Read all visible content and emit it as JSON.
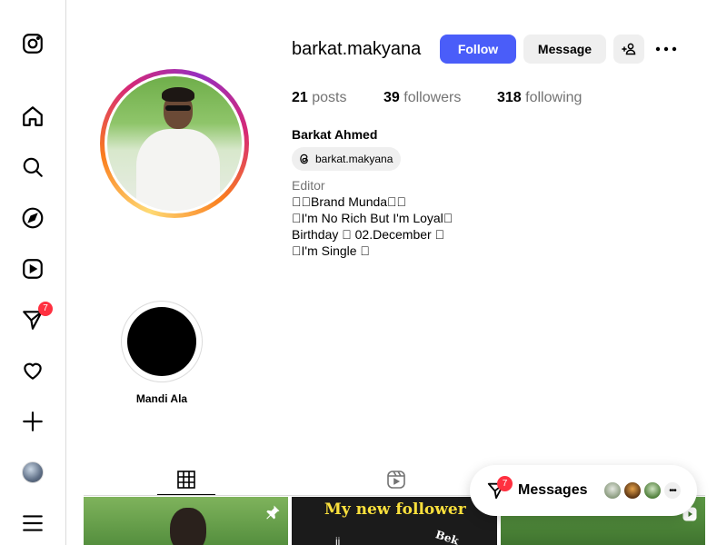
{
  "sidebar": {
    "items": [
      {
        "name": "instagram-logo-icon"
      },
      {
        "name": "home-icon"
      },
      {
        "name": "search-icon"
      },
      {
        "name": "explore-icon"
      },
      {
        "name": "reels-icon"
      },
      {
        "name": "messages-icon",
        "badge": "7"
      },
      {
        "name": "notifications-heart-icon"
      },
      {
        "name": "create-plus-icon"
      },
      {
        "name": "profile-avatar"
      },
      {
        "name": "menu-icon"
      }
    ]
  },
  "profile": {
    "username": "barkat.makyana",
    "follow_label": "Follow",
    "message_label": "Message",
    "posts_count": "21",
    "posts_label": "posts",
    "followers_count": "39",
    "followers_label": "followers",
    "following_count": "318",
    "following_label": "following",
    "full_name": "Barkat Ahmed",
    "threads_handle": "barkat.makyana",
    "category": "Editor",
    "bio": [
      "\u0000\u0000Brand Munda\u0000\u0000",
      "\u0000I'm No Rich But I'm Loyal\u0000",
      "Birthday \u0000 02.December \u0000",
      "\u0000I'm Single \u0000"
    ]
  },
  "highlights": [
    {
      "label": "Mandi Ala"
    }
  ],
  "tabs": [
    {
      "name": "posts-grid",
      "active": true
    },
    {
      "name": "reels",
      "active": false
    }
  ],
  "grid": {
    "post2_title": "My new follower",
    "post2_left_text": "ji",
    "post2_right_text": "Bek"
  },
  "messages": {
    "label": "Messages",
    "badge": "7"
  },
  "colors": {
    "follow_button": "#4a5df9",
    "badge": "#ff3040",
    "secondary_text": "#737373",
    "button_gray": "#efefef"
  }
}
